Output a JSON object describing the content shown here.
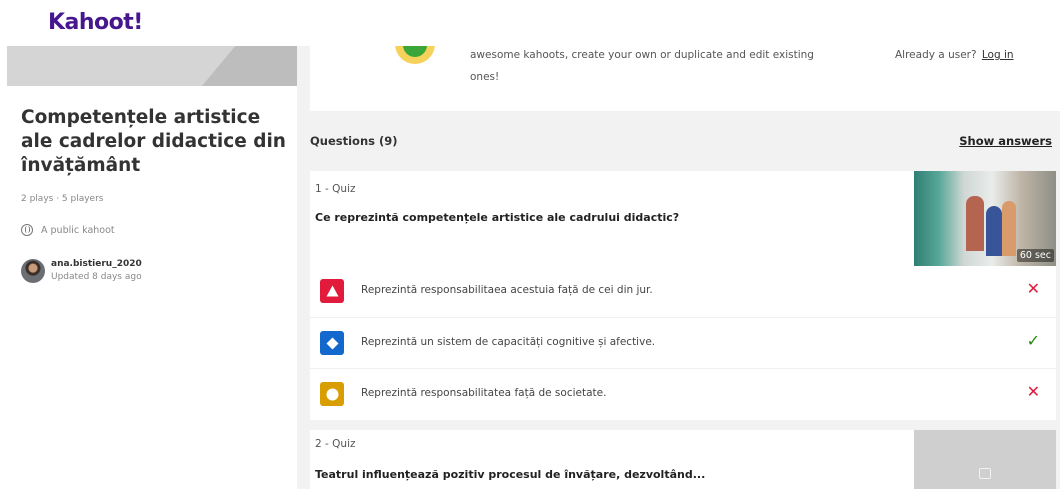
{
  "brand": {
    "logo": "Kahoot!",
    "color": "#46178f"
  },
  "sidebar": {
    "title": "Competențele artistice ale cadrelor didactice din învățământ",
    "stats": "2 plays · 5 players",
    "visibility": "A public kahoot",
    "author": {
      "name": "ana.bistieru_2020",
      "updated": "Updated 8 days ago"
    }
  },
  "banner": {
    "text": "awesome kahoots, create your own or duplicate and edit existing ones!",
    "already_user": "Already a user?",
    "login_label": "Log in"
  },
  "questions_header": {
    "title": "Questions (9)",
    "show_answers": "Show answers"
  },
  "questions": [
    {
      "type_label": "1 - Quiz",
      "text": "Ce reprezintă competențele artistice ale cadrului didactic?",
      "time": "60 sec",
      "answers": [
        {
          "text": "Reprezintă responsabilitaea acestuia față de cei din jur.",
          "shape": "triangle",
          "color": "#e21b3c",
          "correct": false,
          "mark": "✕"
        },
        {
          "text": "Reprezintă un sistem de capacități cognitive și afective.",
          "shape": "diamond",
          "color": "#1368ce",
          "correct": true,
          "mark": "✓"
        },
        {
          "text": "Reprezintă responsabilitatea față de societate.",
          "shape": "circle",
          "color": "#d89e00",
          "correct": false,
          "mark": "✕"
        }
      ]
    },
    {
      "type_label": "2 - Quiz",
      "text": "Teatrul influențează pozitiv procesul de învățare, dezvoltând..."
    }
  ],
  "icons": [
    "globe-icon",
    "triangle-shape-icon",
    "diamond-shape-icon",
    "circle-shape-icon",
    "cross-icon",
    "check-icon",
    "image-placeholder-icon"
  ]
}
